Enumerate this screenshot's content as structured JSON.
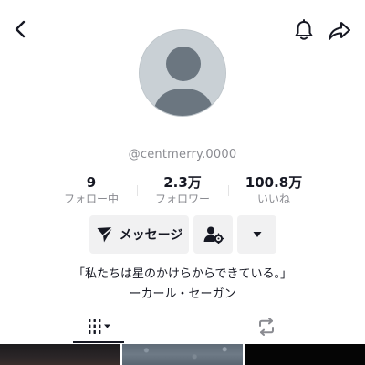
{
  "profile": {
    "username": "@centmerry.0000"
  },
  "stats": {
    "following": {
      "value": "9",
      "label": "フォロー中"
    },
    "followers": {
      "value": "2.3万",
      "label": "フォロワー"
    },
    "likes": {
      "value": "100.8万",
      "label": "いいね"
    }
  },
  "actions": {
    "message_label": "メッセージ"
  },
  "bio": {
    "line1": "「私たちは星のかけらからできている。」",
    "line2": "ーカール・セーガン"
  },
  "icons": {
    "back": "chevron-left-icon",
    "notifications": "bell-icon",
    "share": "share-arrow-icon",
    "message": "send-icon",
    "add_user": "person-gear-icon",
    "more": "caret-down-icon",
    "videos_tab": "grid-icon",
    "repost_tab": "repost-icon"
  },
  "colors": {
    "text_primary": "#161823",
    "text_secondary": "#8a8b91",
    "button_bg": "#f1f1f2",
    "avatar_bg": "#c9d0d5",
    "avatar_figure": "#6b7680"
  }
}
